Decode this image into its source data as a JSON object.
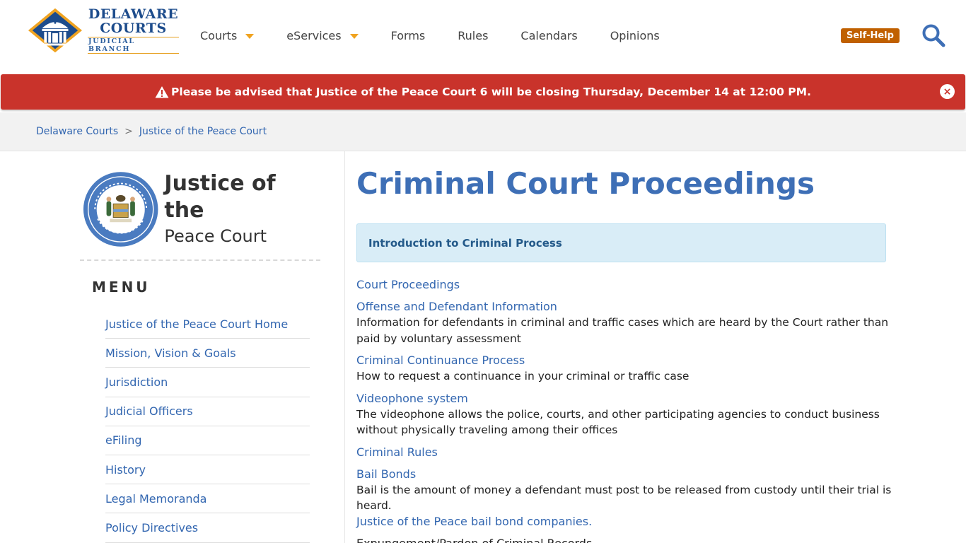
{
  "header": {
    "logo": {
      "line1": "DELAWARE",
      "line2": "COURTS",
      "line3": "JUDICIAL BRANCH"
    },
    "nav": [
      {
        "label": "Courts",
        "dropdown": true
      },
      {
        "label": "eServices",
        "dropdown": true
      },
      {
        "label": "Forms",
        "dropdown": false
      },
      {
        "label": "Rules",
        "dropdown": false
      },
      {
        "label": "Calendars",
        "dropdown": false
      },
      {
        "label": "Opinions",
        "dropdown": false
      }
    ],
    "self_help": "Self-Help",
    "search_icon": "search-icon"
  },
  "alert": {
    "icon": "warning-icon",
    "text": "Please be advised that Justice of the Peace Court 6 will be closing Thursday, December 14 at 12:00 PM.",
    "close": "×",
    "color": "#c9332b"
  },
  "breadcrumb": {
    "items": [
      "Delaware Courts",
      "Justice of the Peace Court"
    ],
    "separator": ">"
  },
  "sidebar": {
    "court_title_line1": "Justice of the",
    "court_title_line2": "Peace Court",
    "menu_label": "MENU",
    "menu_items": [
      "Justice of the Peace Court Home",
      "Mission, Vision & Goals",
      "Jurisdiction",
      "Judicial Officers",
      "eFiling",
      "History",
      "Legal Memoranda",
      "Policy Directives"
    ]
  },
  "main": {
    "title_bold": "Criminal Court",
    "title_light": "Proceedings",
    "intro": "Introduction to Criminal Process",
    "entries": [
      {
        "link": "Court Proceedings",
        "desc": ""
      },
      {
        "link": "Offense and Defendant Information",
        "desc": "Information for defendants in criminal and traffic cases which are heard by the Court rather than paid by voluntary assessment"
      },
      {
        "link": "Criminal Continuance Process",
        "desc": "How to request a continuance in your criminal or traffic case"
      },
      {
        "link": "Videophone system",
        "desc": "The videophone allows the police, courts, and other participating agencies to conduct business without physically traveling among their offices"
      },
      {
        "link": "Criminal Rules",
        "desc": ""
      },
      {
        "link": "Bail Bonds",
        "desc": "Bail is the amount of money a defendant must post to be released from custody until their trial is heard.",
        "extra_link": "Justice of the Peace bail bond companies."
      }
    ],
    "last_item": "Expungement/Pardon of Criminal Records"
  },
  "colors": {
    "brand_blue": "#1d4c8c",
    "link_blue": "#3266b0",
    "accent_orange": "#f0a320",
    "self_help_bg": "#c06000",
    "info_box_bg": "#d9edf7"
  }
}
